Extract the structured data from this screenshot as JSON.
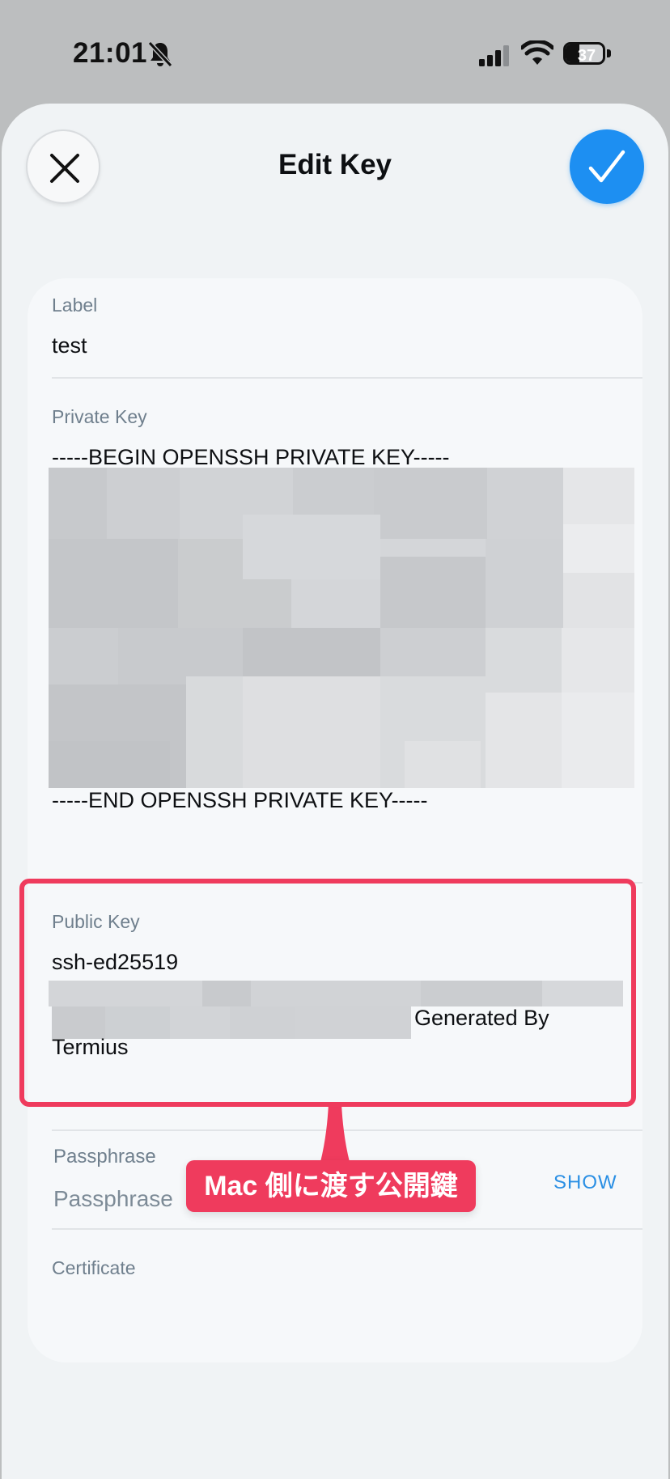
{
  "status_bar": {
    "time": "21:01",
    "battery_level": "37",
    "icons": [
      "bell-off-icon",
      "cellular-signal-icon",
      "wifi-icon",
      "battery-icon"
    ]
  },
  "header": {
    "title": "Edit Key",
    "close_icon": "close-icon",
    "done_icon": "checkmark-icon"
  },
  "form": {
    "label": {
      "label": "Label",
      "value": "test"
    },
    "private_key": {
      "label": "Private Key",
      "begin_line": "-----BEGIN OPENSSH PRIVATE KEY-----",
      "end_line": "-----END OPENSSH PRIVATE KEY-----"
    },
    "public_key": {
      "label": "Public Key",
      "prefix": "ssh-ed25519",
      "suffix": "Generated By Termius"
    },
    "passphrase": {
      "label": "Passphrase",
      "placeholder": "Passphrase",
      "show_label": "SHOW"
    },
    "certificate": {
      "label": "Certificate"
    }
  },
  "annotation": {
    "text": "Mac 側に渡す公開鍵"
  },
  "colors": {
    "accent_blue": "#1d8ff2",
    "annotation_red": "#ef3b5d",
    "sheet_bg": "#f0f3f5",
    "card_bg": "#f6f8fa",
    "label_gray": "#6f7f8d"
  }
}
